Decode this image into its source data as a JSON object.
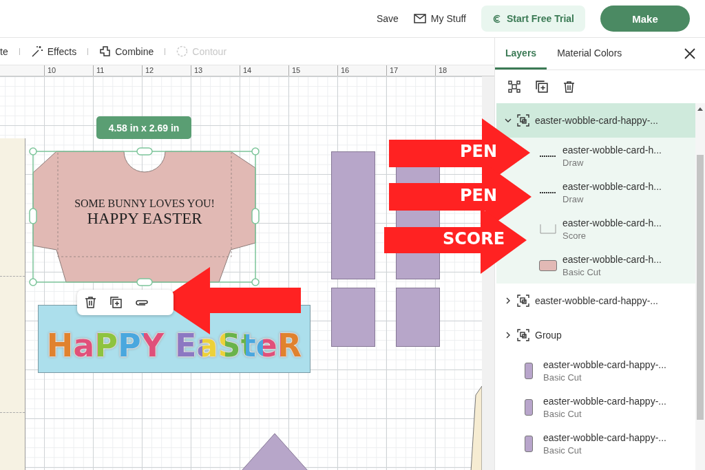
{
  "header": {
    "save": "Save",
    "my_stuff": "My Stuff",
    "trial_button": "Start Free Trial",
    "make_button": "Make"
  },
  "toolbar": [
    {
      "kind": "plain",
      "label": "te",
      "disabled": false
    },
    {
      "kind": "effects",
      "label": "Effects",
      "disabled": false
    },
    {
      "kind": "combine",
      "label": "Combine",
      "disabled": false
    },
    {
      "kind": "contour",
      "label": "Contour",
      "disabled": true
    }
  ],
  "ruler": [
    "10",
    "11",
    "12",
    "13",
    "14",
    "15",
    "16",
    "17",
    "18"
  ],
  "canvas": {
    "size_label": "4.58 in x 2.69 in",
    "envelope_text": [
      "SOME BUNNY LOVES YOU!",
      "HAPPY EASTER"
    ],
    "banner_text": "HaPPY EaSteR"
  },
  "annotations": [
    {
      "label": "PEN"
    },
    {
      "label": "PEN"
    },
    {
      "label": "SCORE"
    }
  ],
  "panel": {
    "tabs": [
      {
        "label": "Layers",
        "selected": true
      },
      {
        "label": "Material Colors",
        "selected": false
      }
    ],
    "layers": [
      {
        "kind": "group",
        "name": "easter-wobble-card-happy-...",
        "expanded": true,
        "selected": true,
        "children": [
          {
            "kind": "draw",
            "name": "easter-wobble-card-h...",
            "operation": "Draw"
          },
          {
            "kind": "draw",
            "name": "easter-wobble-card-h...",
            "operation": "Draw"
          },
          {
            "kind": "score",
            "name": "easter-wobble-card-h...",
            "operation": "Score"
          },
          {
            "kind": "cut",
            "name": "easter-wobble-card-h...",
            "operation": "Basic Cut",
            "color": "#e2b9b5"
          }
        ]
      },
      {
        "kind": "group",
        "name": "easter-wobble-card-happy-...",
        "expanded": false,
        "selected": false
      },
      {
        "kind": "group",
        "name": "Group",
        "expanded": false,
        "selected": false
      },
      {
        "kind": "cut",
        "name": "easter-wobble-card-happy-...",
        "operation": "Basic Cut",
        "color": "#b8a5cb"
      },
      {
        "kind": "cut",
        "name": "easter-wobble-card-happy-...",
        "operation": "Basic Cut",
        "color": "#b8a5cb"
      },
      {
        "kind": "cut",
        "name": "easter-wobble-card-happy-...",
        "operation": "Basic Cut",
        "color": "#b8a5cb"
      }
    ]
  }
}
